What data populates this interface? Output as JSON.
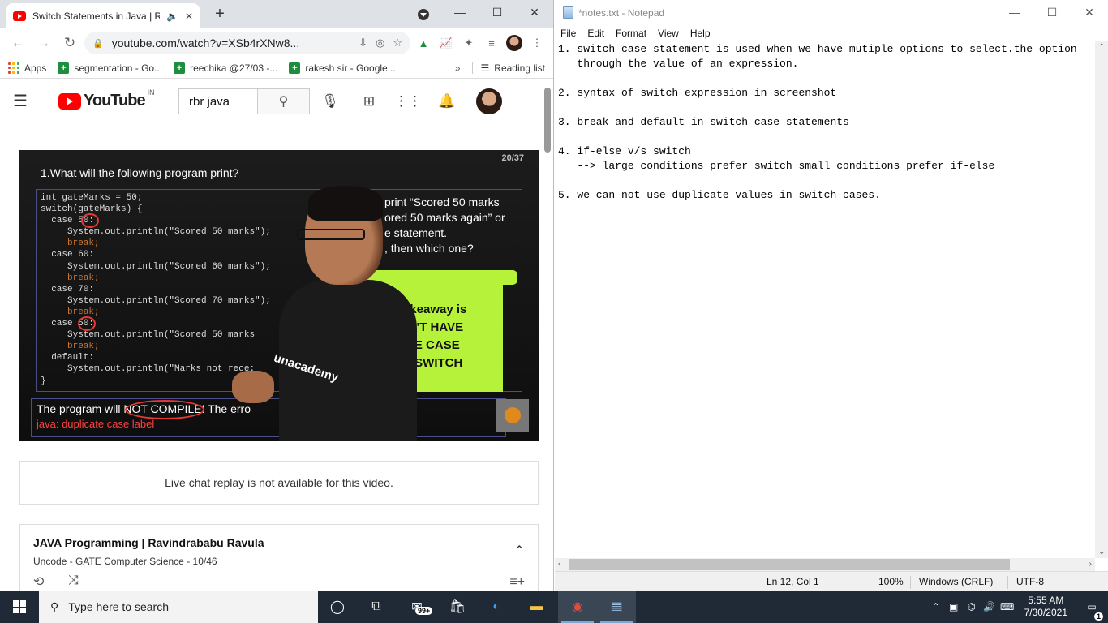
{
  "chrome": {
    "tab_title": "Switch Statements in Java | R",
    "url": "youtube.com/watch?v=XSb4rXNw8...",
    "bookmarks": [
      {
        "label": "Apps"
      },
      {
        "label": "segmentation - Go..."
      },
      {
        "label": "reechika @27/03 -..."
      },
      {
        "label": "rakesh sir - Google..."
      }
    ],
    "more": "»",
    "reading_list": "Reading list"
  },
  "youtube": {
    "logo": "YouTube",
    "country": "IN",
    "search_value": "rbr java"
  },
  "video": {
    "slide_number": "20/37",
    "question": "1.What will the following program print?",
    "code_lines": [
      "int gateMarks = 50;",
      "switch(gateMarks) {",
      "  case 50:",
      "     System.out.println(\"Scored 50 marks\");",
      "     break;",
      "  case 60:",
      "     System.out.println(\"Scored 60 marks\");",
      "     break;",
      "  case 70:",
      "     System.out.println(\"Scored 70 marks\");",
      "     break;",
      "  case 50:",
      "     System.out.println(\"Scored 50 marks",
      "     break;",
      "  default:",
      "     System.out.println(\"Marks not rece:",
      "}"
    ],
    "question_text": "print “Scored 50 marks\nored 50 marks again” or\ne statement.\n, then which one?",
    "takeaway": "takeaway is\nAN'T HAVE\nATE CASE\nIN SWITCH",
    "answer_line1": "The program will NOT COMPILE! The erro",
    "answer_line2": "java: duplicate case label",
    "brand": "unacademy"
  },
  "chat": {
    "text": "Live chat replay is not available for this video."
  },
  "playlist": {
    "title": "JAVA Programming | Ravindrababu Ravula",
    "subtitle": "Uncode - GATE Computer Science - 10/46"
  },
  "notepad": {
    "title": "*notes.txt - Notepad",
    "menu": [
      "File",
      "Edit",
      "Format",
      "View",
      "Help"
    ],
    "content": "1. switch case statement is used when we have mutiple options to select.the option\n   through the value of an expression.\n\n2. syntax of switch expression in screenshot\n\n3. break and default in switch case statements\n\n4. if-else v/s switch\n   --> large conditions prefer switch small conditions prefer if-else\n\n5. we can not use duplicate values in switch cases.",
    "status": {
      "position": "Ln 12, Col 1",
      "zoom": "100%",
      "line_ending": "Windows (CRLF)",
      "encoding": "UTF-8"
    }
  },
  "taskbar": {
    "search_placeholder": "Type here to search",
    "mail_badge": "99+",
    "time": "5:55 AM",
    "date": "7/30/2021",
    "notification_count": "1"
  }
}
